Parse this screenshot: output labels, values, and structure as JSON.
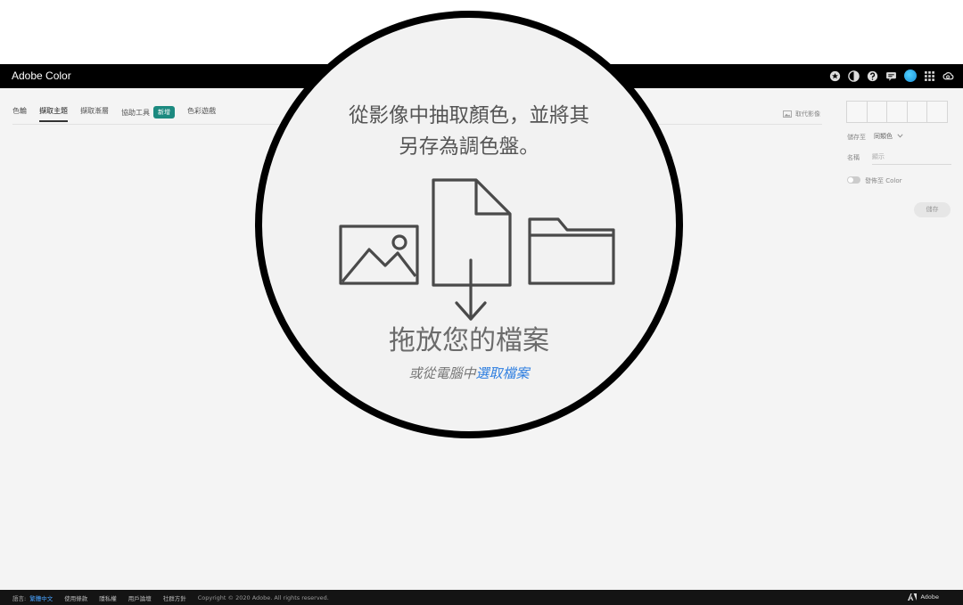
{
  "app": {
    "title": "Adobe Color"
  },
  "header_icons": [
    "explore-icon",
    "trends-icon",
    "help-icon",
    "feedback-icon",
    "profile-avatar",
    "apps-grid-icon",
    "creative-cloud-icon"
  ],
  "tabs": [
    {
      "label": "色輪"
    },
    {
      "label": "擷取主題"
    },
    {
      "label": "擷取漸層"
    },
    {
      "label": "協助工具",
      "badge": "新增"
    },
    {
      "label": "色彩遊戲"
    }
  ],
  "toolbar": {
    "replace_image_label": "取代影像"
  },
  "side_panel": {
    "save_to_label": "儲存至",
    "save_to_value": "同類色",
    "name_label": "名稱",
    "name_placeholder": "顯示",
    "publish_label": "發佈至 Color",
    "save_label": "儲存"
  },
  "dropzone": {
    "heading_line1": "從影像中抽取顏色，並將其",
    "heading_line2": "另存為調色盤。",
    "title": "拖放您的檔案",
    "sub_prefix": "或從電腦中",
    "sub_link": "選取檔案"
  },
  "footer": {
    "language_label": "語言:",
    "language_value": "繁體中文",
    "links": [
      "使用條款",
      "隱私權",
      "用戶論壇",
      "社群方針"
    ],
    "copyright": "Copyright © 2020 Adobe. All rights reserved.",
    "brand": "Adobe"
  },
  "colors": {
    "header_bg": "#000000",
    "badge": "#1c8a80",
    "link": "#2f7fe0",
    "footer_lang": "#49a3ff"
  }
}
